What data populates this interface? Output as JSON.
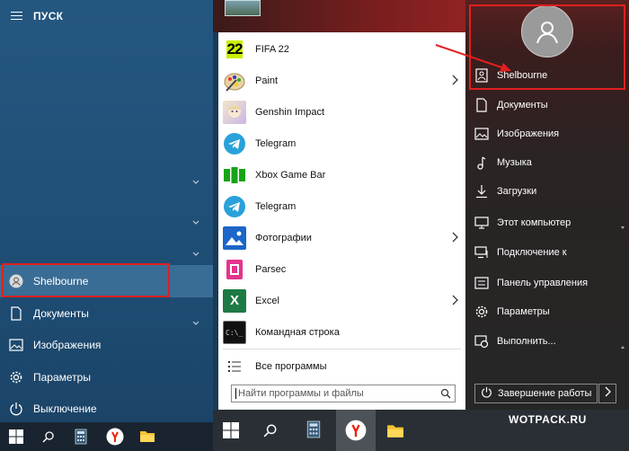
{
  "left_panel": {
    "header": "ПУСК",
    "items": [
      {
        "label": "Shelbourne",
        "icon": "user-icon"
      },
      {
        "label": "Документы",
        "icon": "document-icon"
      },
      {
        "label": "Изображения",
        "icon": "image-icon"
      },
      {
        "label": "Параметры",
        "icon": "gear-icon"
      },
      {
        "label": "Выключение",
        "icon": "power-icon"
      }
    ]
  },
  "menu": {
    "apps": [
      {
        "label": "FIFA 22",
        "icon": "fifa22-icon",
        "badge": "22"
      },
      {
        "label": "Paint",
        "icon": "paint-icon",
        "submenu": true
      },
      {
        "label": "Genshin Impact",
        "icon": "genshin-icon"
      },
      {
        "label": "Telegram",
        "icon": "telegram-icon"
      },
      {
        "label": "Xbox Game Bar",
        "icon": "xbox-game-bar-icon"
      },
      {
        "label": "Telegram",
        "icon": "telegram-icon"
      },
      {
        "label": "Фотографии",
        "icon": "photos-icon",
        "submenu": true
      },
      {
        "label": "Parsec",
        "icon": "parsec-icon"
      },
      {
        "label": "Excel",
        "icon": "excel-icon",
        "submenu": true,
        "badge": "X"
      },
      {
        "label": "Командная строка",
        "icon": "cmd-icon"
      }
    ],
    "all_programs": "Все программы",
    "search_placeholder": "Найти программы и файлы"
  },
  "right_panel": {
    "user": "Shelbourne",
    "items": [
      {
        "label": "Документы",
        "icon": "document-icon"
      },
      {
        "label": "Изображения",
        "icon": "image-icon"
      },
      {
        "label": "Музыка",
        "icon": "music-icon"
      },
      {
        "label": "Загрузки",
        "icon": "download-icon"
      },
      {
        "label": "Этот компьютер",
        "icon": "computer-icon"
      },
      {
        "label": "Подключение к",
        "icon": "connect-icon"
      },
      {
        "label": "Панель управления",
        "icon": "control-panel-icon"
      },
      {
        "label": "Параметры",
        "icon": "gear-icon"
      },
      {
        "label": "Выполнить...",
        "icon": "run-icon"
      }
    ],
    "shutdown": "Завершение работы"
  },
  "watermark": "WOTPACK.RU",
  "colors": {
    "highlight_box": "#e02020",
    "left_bg": "#245780",
    "right_bg": "#262626"
  }
}
